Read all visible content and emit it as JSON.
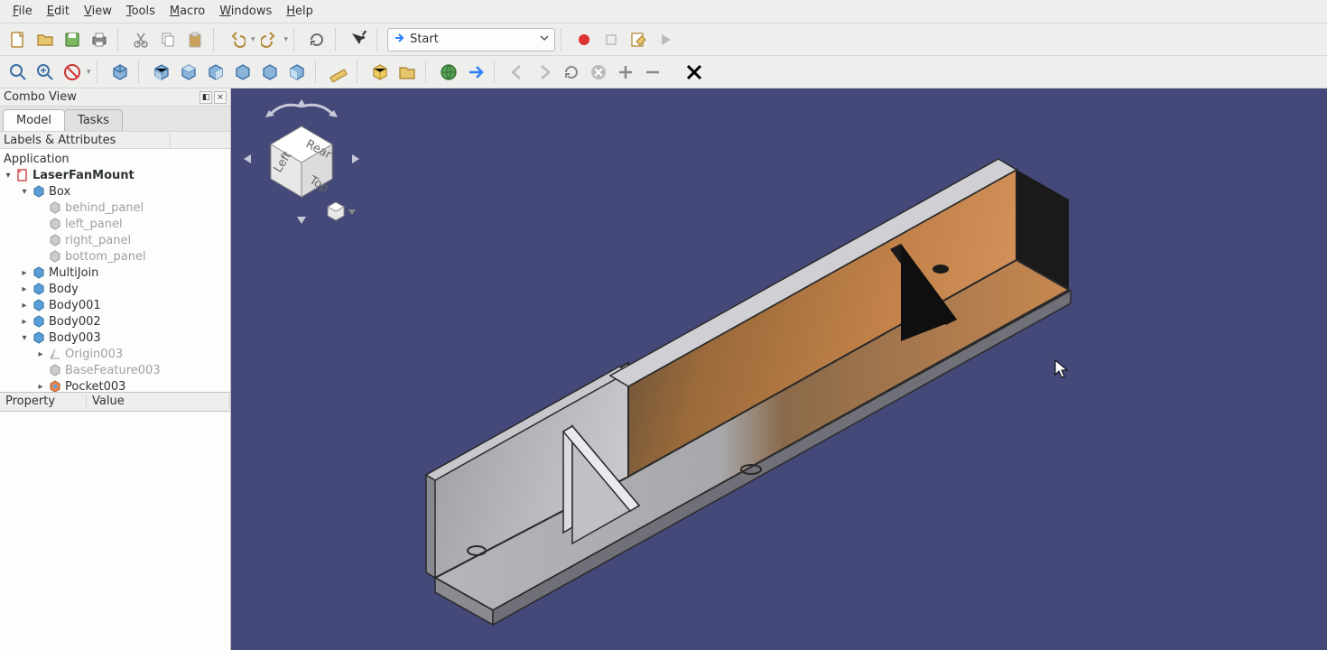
{
  "menubar": {
    "file": "File",
    "edit": "Edit",
    "view": "View",
    "tools": "Tools",
    "macro": "Macro",
    "windows": "Windows",
    "help": "Help"
  },
  "workbench": {
    "label": "Start"
  },
  "combo": {
    "title": "Combo View",
    "tabs": {
      "model": "Model",
      "tasks": "Tasks"
    },
    "labels_header": "Labels & Attributes",
    "app_root": "Application",
    "document": "LaserFanMount",
    "tree": {
      "box": "Box",
      "behind_panel": "behind_panel",
      "left_panel": "left_panel",
      "right_panel": "right_panel",
      "bottom_panel": "bottom_panel",
      "multijoin": "MultiJoin",
      "body": "Body",
      "body001": "Body001",
      "body002": "Body002",
      "body003": "Body003",
      "origin003": "Origin003",
      "basefeature003": "BaseFeature003",
      "pocket003": "Pocket003"
    },
    "prop_header": {
      "property": "Property",
      "value": "Value"
    }
  }
}
